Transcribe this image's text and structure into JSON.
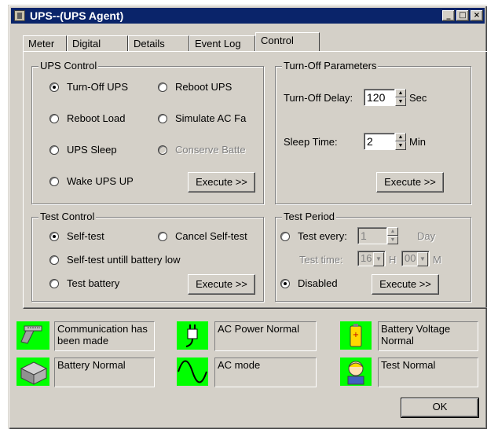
{
  "window": {
    "title": "UPS--(UPS Agent)",
    "minimize_glyph": "_",
    "maximize_glyph": "□",
    "close_glyph": "×"
  },
  "tabs": [
    {
      "label": "Meter"
    },
    {
      "label": "Digital"
    },
    {
      "label": "Details"
    },
    {
      "label": "Event Log"
    },
    {
      "label": "Control",
      "active": true
    }
  ],
  "ups_control": {
    "title": "UPS Control",
    "options": [
      {
        "label": "Turn-Off UPS",
        "checked": true,
        "enabled": true
      },
      {
        "label": "Reboot UPS",
        "checked": false,
        "enabled": true
      },
      {
        "label": "Reboot Load",
        "checked": false,
        "enabled": true
      },
      {
        "label": "Simulate AC Fa",
        "checked": false,
        "enabled": true
      },
      {
        "label": "UPS Sleep",
        "checked": false,
        "enabled": true
      },
      {
        "label": "Conserve Batte",
        "checked": false,
        "enabled": false
      },
      {
        "label": "Wake UPS UP",
        "checked": false,
        "enabled": true
      }
    ],
    "execute_label": "Execute >>"
  },
  "turn_off_params": {
    "title": "Turn-Off Parameters",
    "delay_label": "Turn-Off Delay:",
    "delay_value": "120",
    "delay_unit": "Sec",
    "sleep_label": "Sleep Time:",
    "sleep_value": "2",
    "sleep_unit": "Min",
    "execute_label": "Execute >>"
  },
  "test_control": {
    "title": "Test Control",
    "options": [
      {
        "label": "Self-test",
        "checked": true
      },
      {
        "label": "Cancel Self-test",
        "checked": false
      },
      {
        "label": "Self-test untill battery low",
        "checked": false
      },
      {
        "label": "Test battery",
        "checked": false
      }
    ],
    "execute_label": "Execute >>"
  },
  "test_period": {
    "title": "Test Period",
    "test_every_label": "Test every:",
    "test_every_value": "1",
    "day_label": "Day",
    "test_time_label": "Test time:",
    "hour_value": "16",
    "hour_label": "H",
    "minute_value": "00",
    "minute_label": "M",
    "disabled_label": "Disabled",
    "disabled_checked": true,
    "execute_label": "Execute >>"
  },
  "status": {
    "communication": "Communication has been made",
    "ac_power": "AC Power Normal",
    "battery_voltage": "Battery Voltage Normal",
    "battery": "Battery Normal",
    "ac_mode": "AC mode",
    "test": "Test Normal"
  },
  "icons": {
    "status_bg": "#00ff00",
    "communication": "cable-plug-icon",
    "ac_power": "power-plug-icon",
    "battery_voltage": "battery-icon",
    "battery": "battery-pack-icon",
    "ac_mode": "sine-wave-icon",
    "test": "technician-icon"
  },
  "ok_label": "OK"
}
